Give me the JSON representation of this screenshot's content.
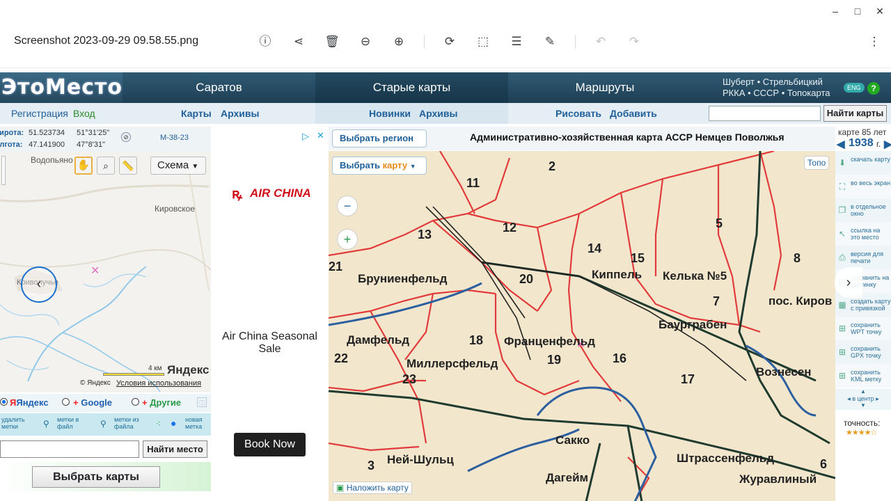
{
  "window": {
    "minimize": "–",
    "maximize": "□",
    "close": "✕"
  },
  "viewer": {
    "filename": "Screenshot 2023-09-29 09.58.55.png",
    "tools": [
      "info-icon",
      "share-icon",
      "delete-icon",
      "zoom-out-icon",
      "zoom-in-icon",
      "rotate-icon",
      "crop-icon",
      "adjust-icon",
      "draw-icon",
      "undo-icon",
      "redo-icon",
      "more-icon"
    ]
  },
  "site": {
    "logo": "ЭтоМесто",
    "nav": [
      "Саратов",
      "Старые карты",
      "Маршруты"
    ],
    "right_line1": "Шуберт • Стрельбицкий",
    "right_line2": "РККА • СССР • Топокарта",
    "eng": "ENG",
    "help": "?",
    "sub": {
      "register": "Регистрация",
      "login": "Вход",
      "maps": "Карты",
      "archives": "Архивы",
      "new": "Новинки",
      "archives2": "Архивы",
      "draw": "Рисовать",
      "add": "Добавить",
      "find_maps": "Найти карты"
    }
  },
  "left": {
    "lat_label": "Широта:",
    "lat_dec": "51.523734",
    "lat_dms": "51°31'25\"",
    "lon_label": "Долгота:",
    "lon_dec": "47.141900",
    "lon_dms": "47°8'31\"",
    "sheet": "M-38-23",
    "scheme": "Схема",
    "places": [
      "Водопьяно",
      "Кировское",
      "Криволучье"
    ],
    "scale": "4 км",
    "yandex": "Яндекс",
    "copyright": "© Яндекс",
    "terms": "Условия использования",
    "sources": [
      "Яндекс",
      "Google",
      "Другие"
    ],
    "tools": [
      {
        "label": "удалить метки"
      },
      {
        "label": "метки в файл"
      },
      {
        "label": "метки из файла"
      },
      {
        "label": "новая метка"
      }
    ],
    "find_place": "Найти место",
    "choose_maps": "Выбрать карты"
  },
  "ad": {
    "brand": "AIR CHINA",
    "headline": "Air China Seasonal Sale",
    "cta": "Book Now"
  },
  "map": {
    "title": "Административно-хозяйственная карта АССР Немцев Поволжья",
    "select_region": "Выбрать регион",
    "select_map_a": "Выбрать ",
    "select_map_b": "карту",
    "topo": "Топо",
    "overlay": "Наложить карту",
    "places": [
      "Бруниенфельд",
      "Киппель",
      "Келька №5",
      "пос. Киров",
      "Баурграбен",
      "Дамфельд",
      "Франценфельд",
      "Миллерсфельд",
      "Вознесен",
      "Сакко",
      "Штрассенфельд",
      "Ней-Шульц",
      "Дагейм",
      "Журавлиный"
    ],
    "numbers": [
      "11",
      "2",
      "12",
      "13",
      "5",
      "14",
      "15",
      "8",
      "21",
      "20",
      "7",
      "18",
      "19",
      "16",
      "22",
      "23",
      "17",
      "3",
      "6"
    ]
  },
  "right": {
    "year_label": "карте 85 лет",
    "year": "1938",
    "year_suffix": "г.",
    "tools": [
      "скачать карту",
      "во весь экран",
      "в отдельное окно",
      "ссылка на это место",
      "версия для печати",
      "сохранить на картинку",
      "создать карту с привязкой",
      "сохранить WPT точку",
      "сохранить GPX точку",
      "сохранить KML метку"
    ],
    "center": "в центр",
    "accuracy": "точность:",
    "stars": "★★★★☆"
  }
}
